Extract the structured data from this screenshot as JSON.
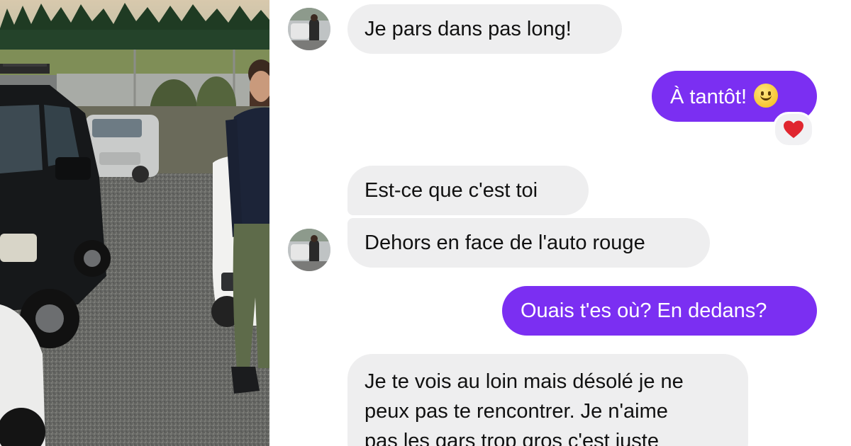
{
  "conversation": {
    "messages": [
      {
        "id": "m1",
        "direction": "incoming",
        "text": "Je pars dans pas long!"
      },
      {
        "id": "m2",
        "direction": "outgoing",
        "text": "À tantôt!",
        "emoji": "slightly-smiling-face-icon",
        "reaction": "heart-icon"
      },
      {
        "id": "m3",
        "direction": "incoming",
        "text": "Est-ce que c'est toi"
      },
      {
        "id": "m4",
        "direction": "incoming",
        "text": "Dehors en face de l'auto rouge"
      },
      {
        "id": "m5",
        "direction": "outgoing",
        "text": "Ouais t'es où? En dedans?"
      },
      {
        "id": "m6",
        "direction": "incoming",
        "lines": [
          "Je te vois au loin mais désolé je ne",
          "peux pas te rencontrer. Je n'aime",
          "pas les gars trop gros c'est juste"
        ]
      }
    ]
  },
  "colors": {
    "outgoing_bubble": "#7b2ff2",
    "incoming_bubble": "#eeeeef",
    "reaction_heart": "#e0262f"
  },
  "icons": {
    "avatar": "profile-photo-avatar",
    "reaction": "heart-icon",
    "emoji": "slightly-smiling-face-icon"
  }
}
